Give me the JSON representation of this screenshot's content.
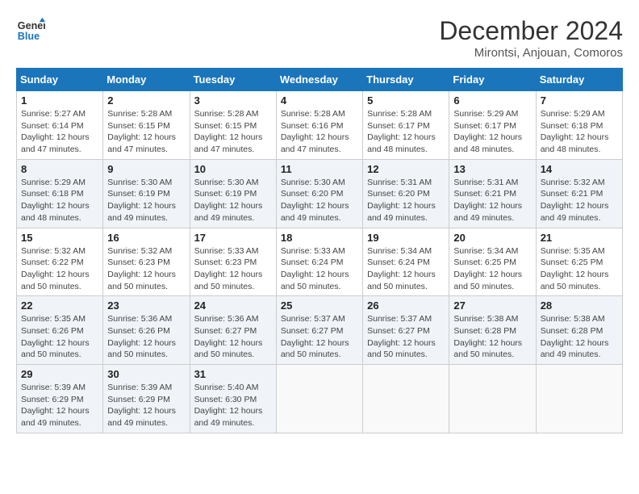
{
  "logo": {
    "line1": "General",
    "line2": "Blue"
  },
  "title": "December 2024",
  "location": "Mirontsi, Anjouan, Comoros",
  "weekdays": [
    "Sunday",
    "Monday",
    "Tuesday",
    "Wednesday",
    "Thursday",
    "Friday",
    "Saturday"
  ],
  "weeks": [
    [
      {
        "day": "1",
        "sunrise": "Sunrise: 5:27 AM",
        "sunset": "Sunset: 6:14 PM",
        "daylight": "Daylight: 12 hours and 47 minutes."
      },
      {
        "day": "2",
        "sunrise": "Sunrise: 5:28 AM",
        "sunset": "Sunset: 6:15 PM",
        "daylight": "Daylight: 12 hours and 47 minutes."
      },
      {
        "day": "3",
        "sunrise": "Sunrise: 5:28 AM",
        "sunset": "Sunset: 6:15 PM",
        "daylight": "Daylight: 12 hours and 47 minutes."
      },
      {
        "day": "4",
        "sunrise": "Sunrise: 5:28 AM",
        "sunset": "Sunset: 6:16 PM",
        "daylight": "Daylight: 12 hours and 47 minutes."
      },
      {
        "day": "5",
        "sunrise": "Sunrise: 5:28 AM",
        "sunset": "Sunset: 6:17 PM",
        "daylight": "Daylight: 12 hours and 48 minutes."
      },
      {
        "day": "6",
        "sunrise": "Sunrise: 5:29 AM",
        "sunset": "Sunset: 6:17 PM",
        "daylight": "Daylight: 12 hours and 48 minutes."
      },
      {
        "day": "7",
        "sunrise": "Sunrise: 5:29 AM",
        "sunset": "Sunset: 6:18 PM",
        "daylight": "Daylight: 12 hours and 48 minutes."
      }
    ],
    [
      {
        "day": "8",
        "sunrise": "Sunrise: 5:29 AM",
        "sunset": "Sunset: 6:18 PM",
        "daylight": "Daylight: 12 hours and 48 minutes."
      },
      {
        "day": "9",
        "sunrise": "Sunrise: 5:30 AM",
        "sunset": "Sunset: 6:19 PM",
        "daylight": "Daylight: 12 hours and 49 minutes."
      },
      {
        "day": "10",
        "sunrise": "Sunrise: 5:30 AM",
        "sunset": "Sunset: 6:19 PM",
        "daylight": "Daylight: 12 hours and 49 minutes."
      },
      {
        "day": "11",
        "sunrise": "Sunrise: 5:30 AM",
        "sunset": "Sunset: 6:20 PM",
        "daylight": "Daylight: 12 hours and 49 minutes."
      },
      {
        "day": "12",
        "sunrise": "Sunrise: 5:31 AM",
        "sunset": "Sunset: 6:20 PM",
        "daylight": "Daylight: 12 hours and 49 minutes."
      },
      {
        "day": "13",
        "sunrise": "Sunrise: 5:31 AM",
        "sunset": "Sunset: 6:21 PM",
        "daylight": "Daylight: 12 hours and 49 minutes."
      },
      {
        "day": "14",
        "sunrise": "Sunrise: 5:32 AM",
        "sunset": "Sunset: 6:21 PM",
        "daylight": "Daylight: 12 hours and 49 minutes."
      }
    ],
    [
      {
        "day": "15",
        "sunrise": "Sunrise: 5:32 AM",
        "sunset": "Sunset: 6:22 PM",
        "daylight": "Daylight: 12 hours and 50 minutes."
      },
      {
        "day": "16",
        "sunrise": "Sunrise: 5:32 AM",
        "sunset": "Sunset: 6:23 PM",
        "daylight": "Daylight: 12 hours and 50 minutes."
      },
      {
        "day": "17",
        "sunrise": "Sunrise: 5:33 AM",
        "sunset": "Sunset: 6:23 PM",
        "daylight": "Daylight: 12 hours and 50 minutes."
      },
      {
        "day": "18",
        "sunrise": "Sunrise: 5:33 AM",
        "sunset": "Sunset: 6:24 PM",
        "daylight": "Daylight: 12 hours and 50 minutes."
      },
      {
        "day": "19",
        "sunrise": "Sunrise: 5:34 AM",
        "sunset": "Sunset: 6:24 PM",
        "daylight": "Daylight: 12 hours and 50 minutes."
      },
      {
        "day": "20",
        "sunrise": "Sunrise: 5:34 AM",
        "sunset": "Sunset: 6:25 PM",
        "daylight": "Daylight: 12 hours and 50 minutes."
      },
      {
        "day": "21",
        "sunrise": "Sunrise: 5:35 AM",
        "sunset": "Sunset: 6:25 PM",
        "daylight": "Daylight: 12 hours and 50 minutes."
      }
    ],
    [
      {
        "day": "22",
        "sunrise": "Sunrise: 5:35 AM",
        "sunset": "Sunset: 6:26 PM",
        "daylight": "Daylight: 12 hours and 50 minutes."
      },
      {
        "day": "23",
        "sunrise": "Sunrise: 5:36 AM",
        "sunset": "Sunset: 6:26 PM",
        "daylight": "Daylight: 12 hours and 50 minutes."
      },
      {
        "day": "24",
        "sunrise": "Sunrise: 5:36 AM",
        "sunset": "Sunset: 6:27 PM",
        "daylight": "Daylight: 12 hours and 50 minutes."
      },
      {
        "day": "25",
        "sunrise": "Sunrise: 5:37 AM",
        "sunset": "Sunset: 6:27 PM",
        "daylight": "Daylight: 12 hours and 50 minutes."
      },
      {
        "day": "26",
        "sunrise": "Sunrise: 5:37 AM",
        "sunset": "Sunset: 6:27 PM",
        "daylight": "Daylight: 12 hours and 50 minutes."
      },
      {
        "day": "27",
        "sunrise": "Sunrise: 5:38 AM",
        "sunset": "Sunset: 6:28 PM",
        "daylight": "Daylight: 12 hours and 50 minutes."
      },
      {
        "day": "28",
        "sunrise": "Sunrise: 5:38 AM",
        "sunset": "Sunset: 6:28 PM",
        "daylight": "Daylight: 12 hours and 49 minutes."
      }
    ],
    [
      {
        "day": "29",
        "sunrise": "Sunrise: 5:39 AM",
        "sunset": "Sunset: 6:29 PM",
        "daylight": "Daylight: 12 hours and 49 minutes."
      },
      {
        "day": "30",
        "sunrise": "Sunrise: 5:39 AM",
        "sunset": "Sunset: 6:29 PM",
        "daylight": "Daylight: 12 hours and 49 minutes."
      },
      {
        "day": "31",
        "sunrise": "Sunrise: 5:40 AM",
        "sunset": "Sunset: 6:30 PM",
        "daylight": "Daylight: 12 hours and 49 minutes."
      },
      {
        "day": "",
        "sunrise": "",
        "sunset": "",
        "daylight": ""
      },
      {
        "day": "",
        "sunrise": "",
        "sunset": "",
        "daylight": ""
      },
      {
        "day": "",
        "sunrise": "",
        "sunset": "",
        "daylight": ""
      },
      {
        "day": "",
        "sunrise": "",
        "sunset": "",
        "daylight": ""
      }
    ]
  ]
}
